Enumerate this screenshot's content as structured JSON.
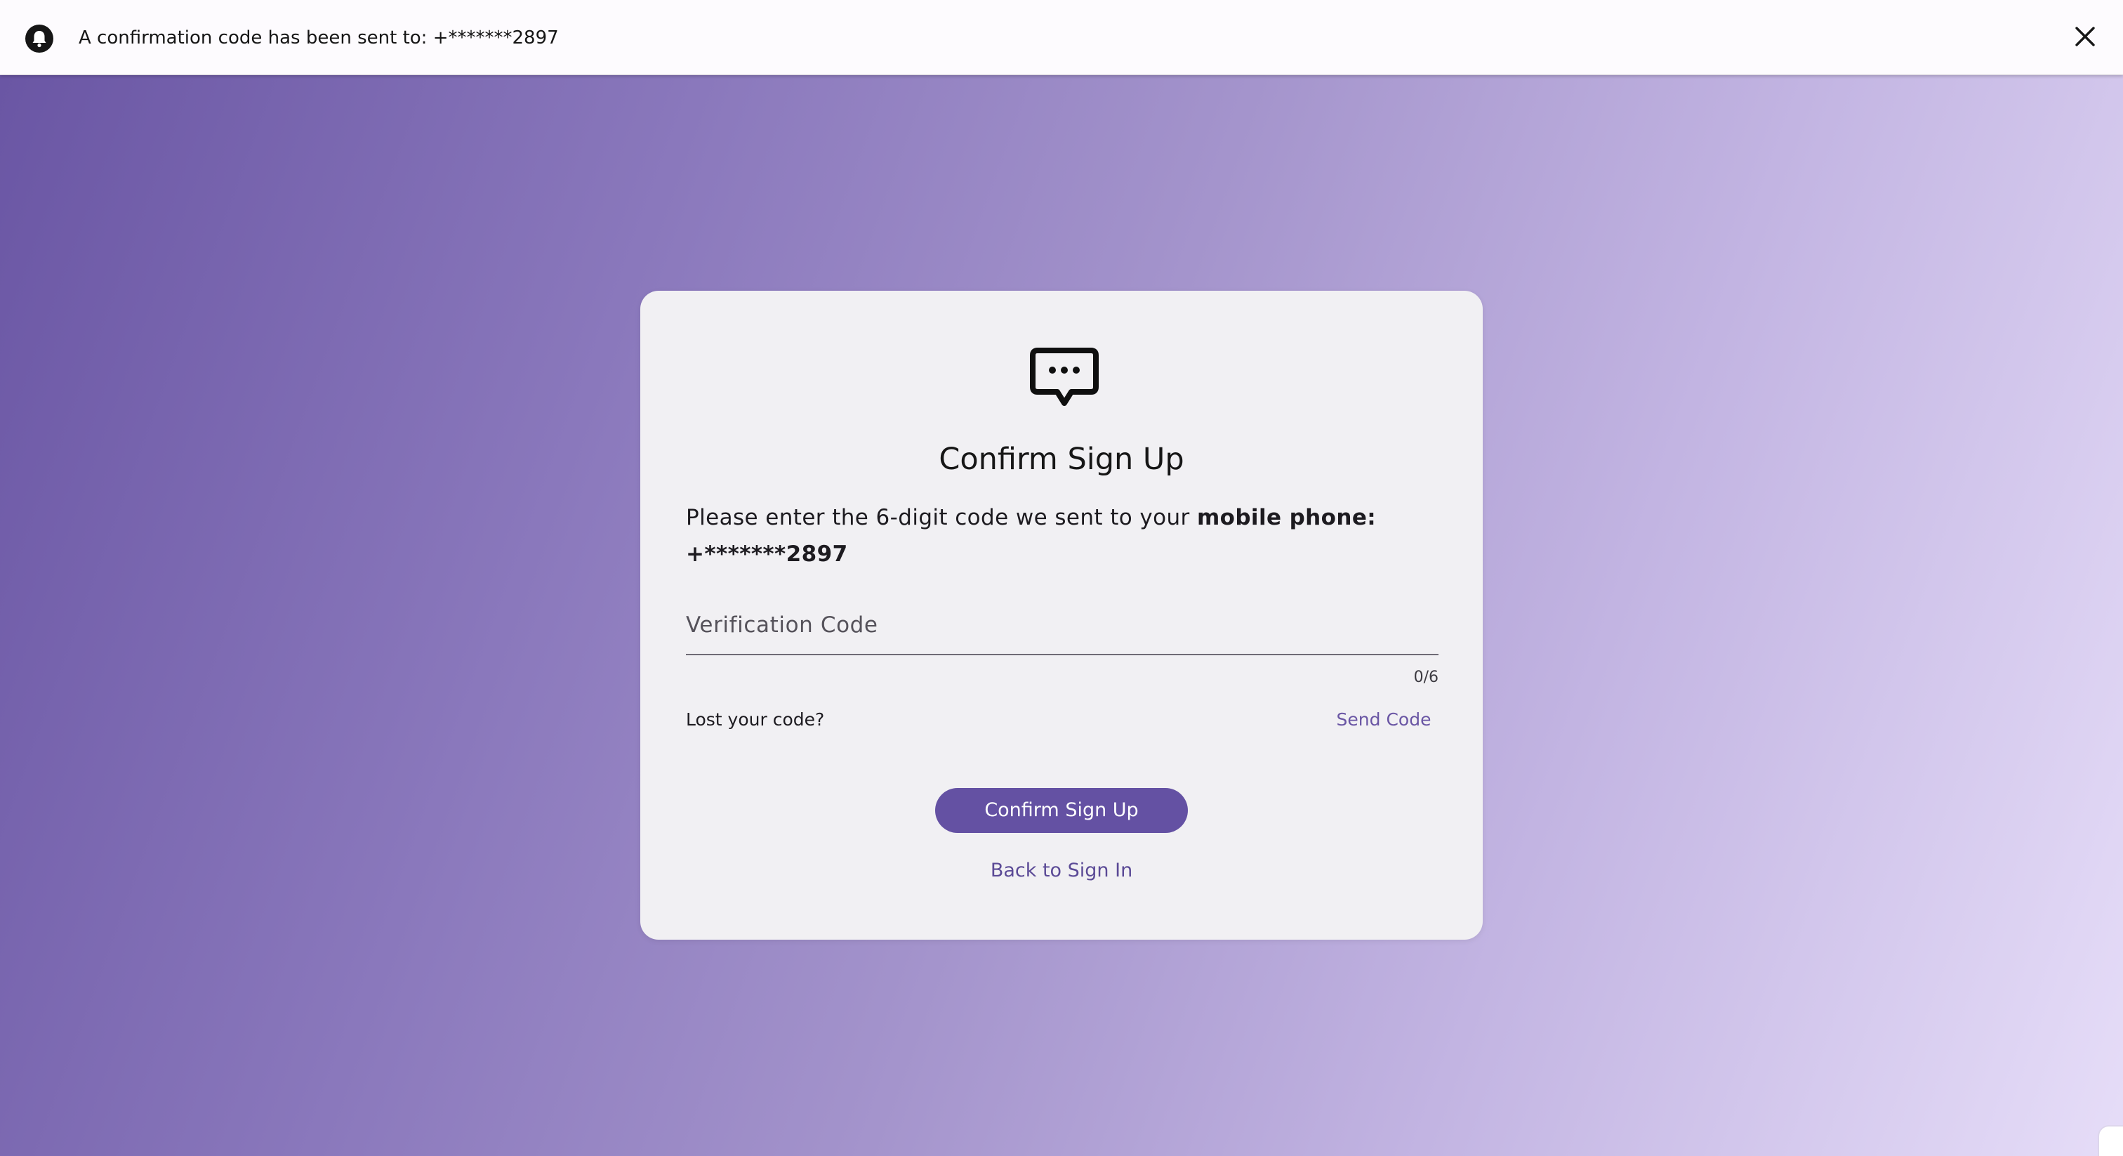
{
  "notification": {
    "icon": "bell-icon",
    "message": "A confirmation code has been sent to: +*******2897",
    "close_icon": "close-icon"
  },
  "card": {
    "icon": "chat-bubble-icon",
    "title": "Confirm Sign Up",
    "instructions_prefix": "Please enter the 6-digit code we sent to your ",
    "instructions_channel": "mobile phone: +*******2897",
    "code_field": {
      "placeholder": "Verification Code",
      "value": "",
      "counter": "0/6"
    },
    "lost_code_label": "Lost your code?",
    "send_code_label": "Send Code",
    "confirm_button_label": "Confirm Sign Up",
    "back_link_label": "Back to Sign In"
  },
  "colors": {
    "accent": "#6451a3",
    "link": "#6a56a4",
    "card_background": "#f1f0f3",
    "gradient_start": "#6a56a4",
    "gradient_end": "#e6ddf8"
  }
}
